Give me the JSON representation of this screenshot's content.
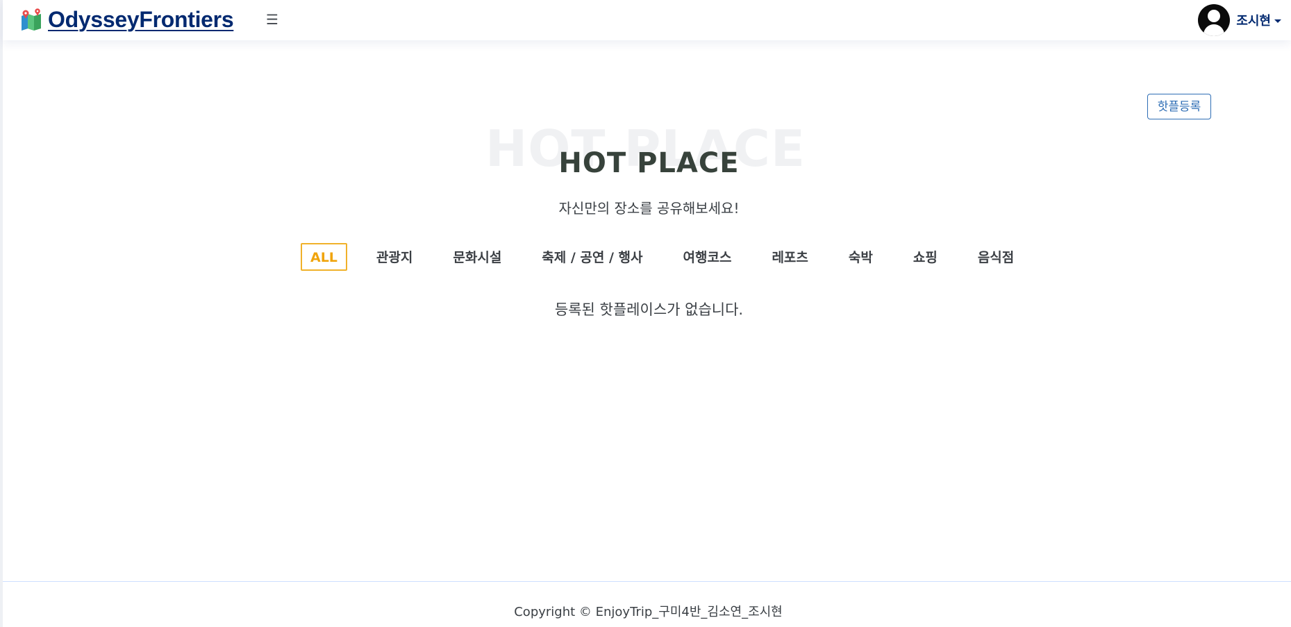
{
  "header": {
    "logo_text": "OdysseyFrontiers",
    "logo_icon": "map-pin-icon",
    "menu_icon": "hamburger-icon",
    "user_name": "조시현"
  },
  "main": {
    "register_button": "핫플등록",
    "title_background": "HOT PLACE",
    "title": "HOT PLACE",
    "subtitle": "자신만의 장소를 공유해보세요!",
    "filters": [
      "ALL",
      "관광지",
      "문화시설",
      "축제 / 공연 / 행사",
      "여행코스",
      "레포츠",
      "숙박",
      "쇼핑",
      "음식점"
    ],
    "active_filter": "ALL",
    "empty_message": "등록된 핫플레이스가 없습니다."
  },
  "footer": {
    "copyright": "Copyright © EnjoyTrip_구미4반_김소연_조시현"
  },
  "colors": {
    "brand": "#012970",
    "accent": "#f0a40b",
    "button_outline": "#2d6db5"
  }
}
